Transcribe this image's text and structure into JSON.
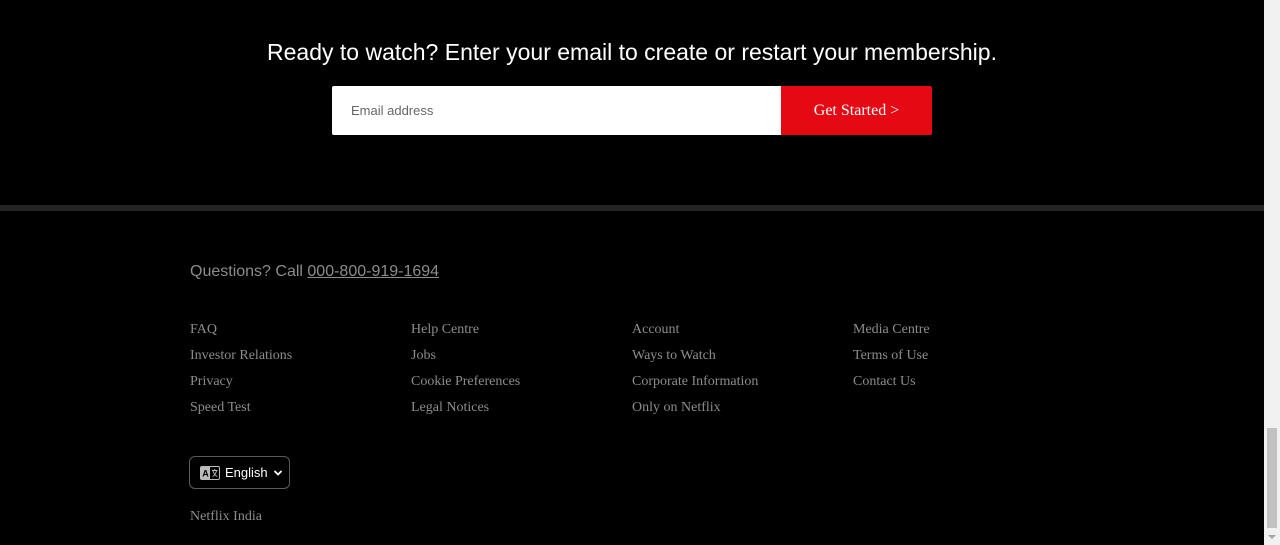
{
  "cta": {
    "heading": "Ready to watch? Enter your email to create or restart your membership.",
    "email_placeholder": "Email address",
    "button_label": "Get Started",
    "button_arrow": ">"
  },
  "footer": {
    "questions_prefix": "Questions? Call ",
    "phone": "000-800-919-1694",
    "links": [
      "FAQ",
      "Help Centre",
      "Account",
      "Media Centre",
      "Investor Relations",
      "Jobs",
      "Ways to Watch",
      "Terms of Use",
      "Privacy",
      "Cookie Preferences",
      "Corporate Information",
      "Contact Us",
      "Speed Test",
      "Legal Notices",
      "Only on Netflix"
    ],
    "language": "English",
    "country": "Netflix India"
  },
  "colors": {
    "accent": "#e50914",
    "muted_text": "#8c8c8c",
    "background": "#000000"
  },
  "icons": {
    "language": "language-icon",
    "chevron": "chevron-down-icon"
  }
}
